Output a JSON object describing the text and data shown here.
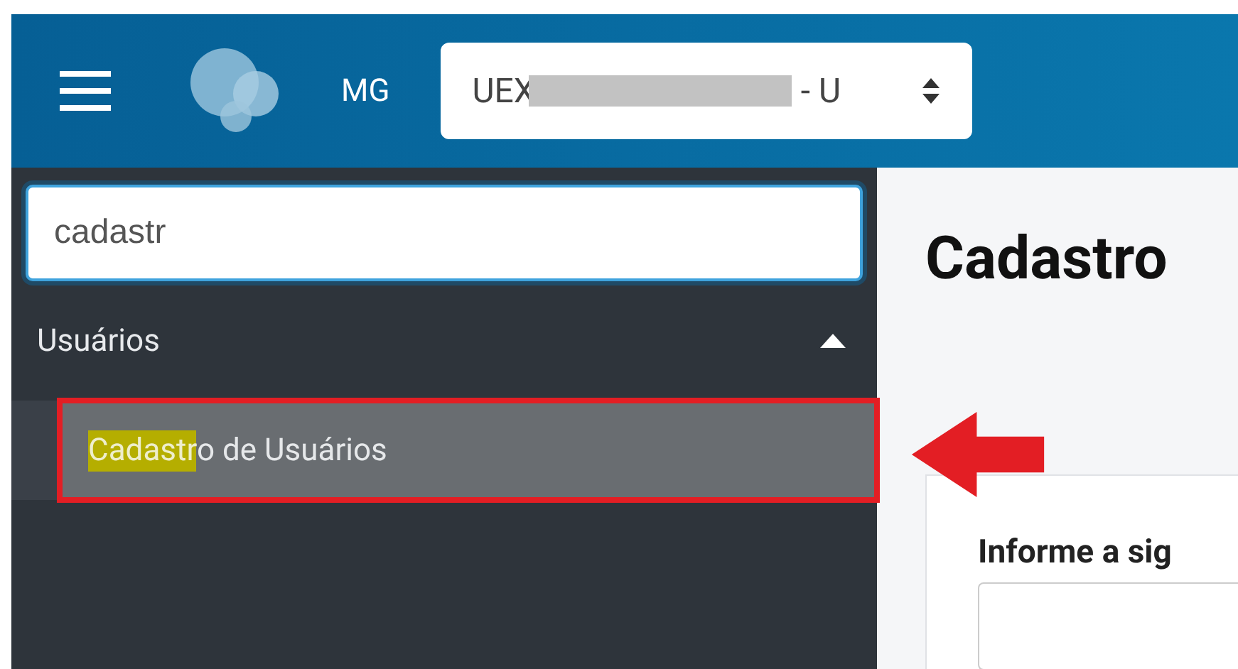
{
  "header": {
    "user_initials": "MG",
    "unit_selector": {
      "value_start": "UEX",
      "value_end": "- U",
      "redacted": true
    }
  },
  "sidebar": {
    "search": {
      "value": "cadastr"
    },
    "groups": [
      {
        "label": "Usuários",
        "expanded": true,
        "items": [
          {
            "match": "Cadastr",
            "rest": "o de Usuários",
            "selected": true,
            "annotated": true
          }
        ]
      }
    ]
  },
  "content": {
    "title": "Cadastro",
    "field_label": "Informe a sig"
  }
}
